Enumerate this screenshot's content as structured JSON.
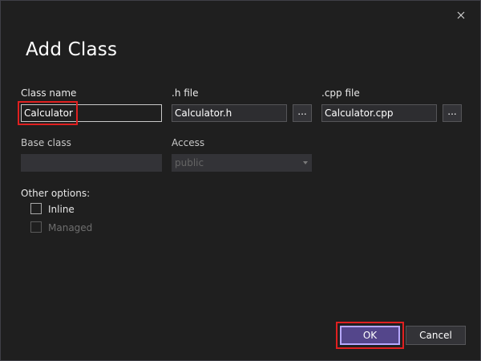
{
  "dialog": {
    "title": "Add Class",
    "close_icon": "close-icon"
  },
  "fields": {
    "class_name": {
      "label": "Class name",
      "value": "Calculator"
    },
    "h_file": {
      "label": ".h file",
      "value": "Calculator.h",
      "browse_label": "..."
    },
    "cpp_file": {
      "label": ".cpp file",
      "value": "Calculator.cpp",
      "browse_label": "..."
    },
    "base_class": {
      "label": "Base class",
      "value": ""
    },
    "access": {
      "label": "Access",
      "selected": "public"
    }
  },
  "other_options": {
    "label": "Other options:",
    "inline": {
      "label": "Inline",
      "checked": false,
      "enabled": true
    },
    "managed": {
      "label": "Managed",
      "checked": false,
      "enabled": false
    }
  },
  "buttons": {
    "ok_label": "OK",
    "cancel_label": "Cancel"
  },
  "colors": {
    "background": "#1f1f1f",
    "primary_button": "#54468b",
    "highlight": "#e02020"
  }
}
